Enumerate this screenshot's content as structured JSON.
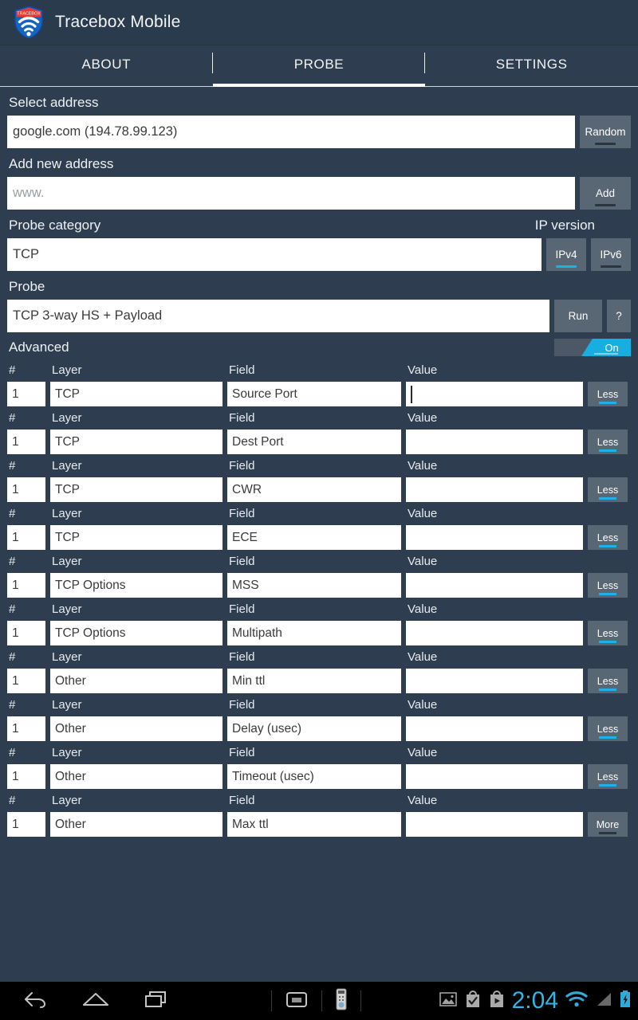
{
  "header": {
    "app_title": "Tracebox Mobile",
    "logo_text": "TRACEBOX",
    "logo_icon": "tracebox-shield-wifi-icon"
  },
  "tabs": [
    {
      "label": "ABOUT",
      "active": false
    },
    {
      "label": "PROBE",
      "active": true
    },
    {
      "label": "SETTINGS",
      "active": false
    }
  ],
  "select_address": {
    "label": "Select address",
    "value": "google.com (194.78.99.123)",
    "button": "Random"
  },
  "add_address": {
    "label": "Add new address",
    "placeholder": "www.",
    "value": "",
    "button": "Add"
  },
  "probe_category": {
    "label": "Probe category",
    "value": "TCP"
  },
  "ip_version": {
    "label": "IP version",
    "options": [
      "IPv4",
      "IPv6"
    ],
    "selected": "IPv4",
    "accent_color": "#18aee0"
  },
  "probe": {
    "label": "Probe",
    "value": "TCP 3-way HS + Payload",
    "run_button": "Run",
    "help_button": "?"
  },
  "advanced": {
    "label": "Advanced",
    "toggle_state": "On",
    "columns": [
      "#",
      "Layer",
      "Field",
      "Value"
    ],
    "rows": [
      {
        "num": "1",
        "layer": "TCP",
        "field": "Source Port",
        "value": "",
        "button": "Less",
        "focused": true
      },
      {
        "num": "1",
        "layer": "TCP",
        "field": "Dest Port",
        "value": "",
        "button": "Less",
        "focused": false
      },
      {
        "num": "1",
        "layer": "TCP",
        "field": "CWR",
        "value": "",
        "button": "Less",
        "focused": false
      },
      {
        "num": "1",
        "layer": "TCP",
        "field": "ECE",
        "value": "",
        "button": "Less",
        "focused": false
      },
      {
        "num": "1",
        "layer": "TCP Options",
        "field": "MSS",
        "value": "",
        "button": "Less",
        "focused": false
      },
      {
        "num": "1",
        "layer": "TCP Options",
        "field": "Multipath",
        "value": "",
        "button": "Less",
        "focused": false
      },
      {
        "num": "1",
        "layer": "Other",
        "field": "Min ttl",
        "value": "",
        "button": "Less",
        "focused": false
      },
      {
        "num": "1",
        "layer": "Other",
        "field": "Delay (usec)",
        "value": "",
        "button": "Less",
        "focused": false
      },
      {
        "num": "1",
        "layer": "Other",
        "field": "Timeout (usec)",
        "value": "",
        "button": "Less",
        "focused": false
      },
      {
        "num": "1",
        "layer": "Other",
        "field": "Max ttl",
        "value": "",
        "button": "More",
        "focused": false
      }
    ]
  },
  "navbar": {
    "back_icon": "back-arrow-icon",
    "home_icon": "home-icon",
    "recents_icon": "recent-apps-icon",
    "screenshot_icon": "screenshot-icon",
    "remote_icon": "remote-control-icon",
    "status_icons": [
      "image-icon",
      "apk-installed-icon",
      "play-store-icon"
    ],
    "clock": "2:04",
    "wifi_icon": "wifi-icon",
    "signal_icon": "cell-signal-icon",
    "battery_icon": "battery-charging-icon",
    "clock_color": "#33b5e5"
  },
  "theme": {
    "background": "#2e3e50",
    "header_bg": "#2b3b4e",
    "accent": "#18aee0",
    "button_bg": "#596674",
    "input_bg": "#ffffff"
  }
}
